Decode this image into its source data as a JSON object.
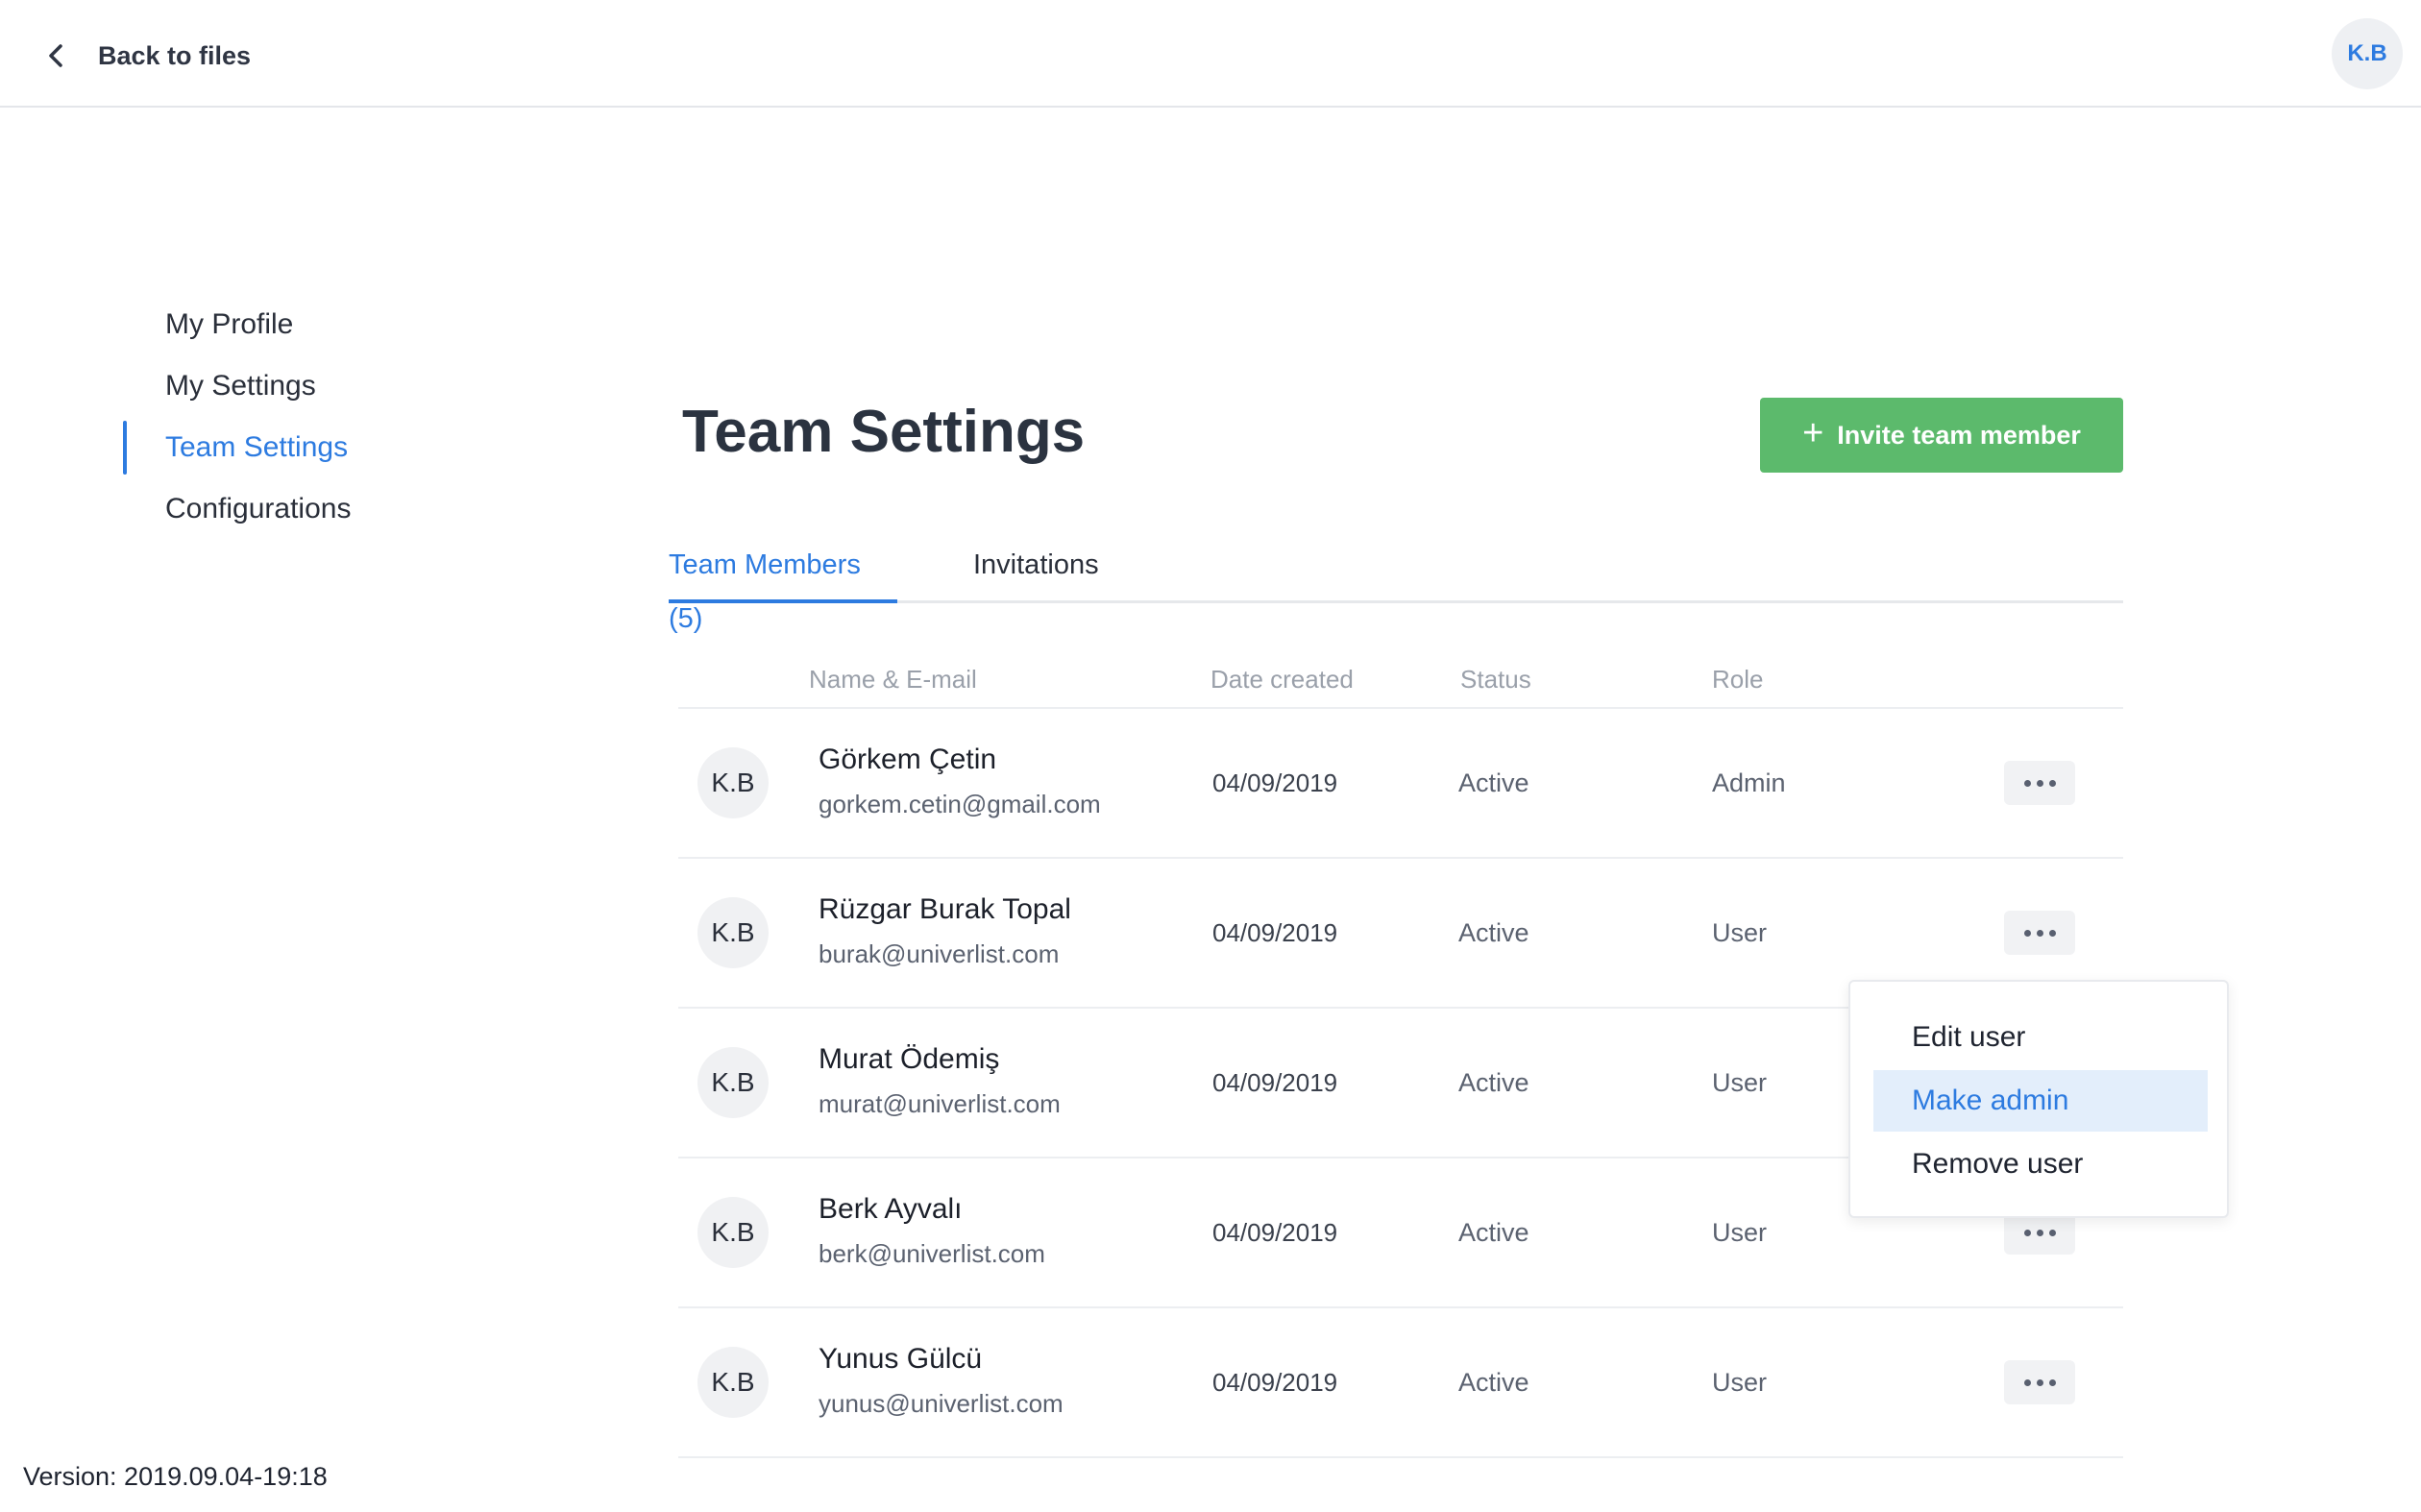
{
  "header": {
    "back_label": "Back to files",
    "user_initials": "K.B"
  },
  "sidebar": {
    "items": [
      {
        "label": "My Profile",
        "active": false
      },
      {
        "label": "My Settings",
        "active": false
      },
      {
        "label": "Team Settings",
        "active": true
      },
      {
        "label": "Configurations",
        "active": false
      }
    ]
  },
  "main": {
    "title": "Team Settings",
    "invite_button": {
      "icon": "plus-icon",
      "label": "Invite team member"
    },
    "tabs": [
      {
        "label": "Team Members (5)",
        "active": true
      },
      {
        "label": "Invitations",
        "active": false
      }
    ],
    "table": {
      "columns": [
        "Name & E-mail",
        "Date created",
        "Status",
        "Role"
      ],
      "rows": [
        {
          "initials": "K.B",
          "name": "Görkem Çetin",
          "email": "gorkem.cetin@gmail.com",
          "date": "04/09/2019",
          "status": "Active",
          "role": "Admin"
        },
        {
          "initials": "K.B",
          "name": "Rüzgar Burak Topal",
          "email": "burak@univerlist.com",
          "date": "04/09/2019",
          "status": "Active",
          "role": "User"
        },
        {
          "initials": "K.B",
          "name": "Murat Ödemiş",
          "email": "murat@univerlist.com",
          "date": "04/09/2019",
          "status": "Active",
          "role": "User"
        },
        {
          "initials": "K.B",
          "name": "Berk Ayvalı",
          "email": "berk@univerlist.com",
          "date": "04/09/2019",
          "status": "Active",
          "role": "User"
        },
        {
          "initials": "K.B",
          "name": "Yunus Gülcü",
          "email": "yunus@univerlist.com",
          "date": "04/09/2019",
          "status": "Active",
          "role": "User"
        }
      ]
    },
    "row_menu": {
      "items": [
        {
          "label": "Edit user",
          "highlighted": false
        },
        {
          "label": "Make admin",
          "highlighted": true
        },
        {
          "label": "Remove user",
          "highlighted": false
        }
      ]
    }
  },
  "footer": {
    "version": "Version: 2019.09.04-19:18"
  },
  "colors": {
    "accent": "#2d7be0",
    "success": "#5cba6c",
    "highlight": "#e3eefb"
  }
}
